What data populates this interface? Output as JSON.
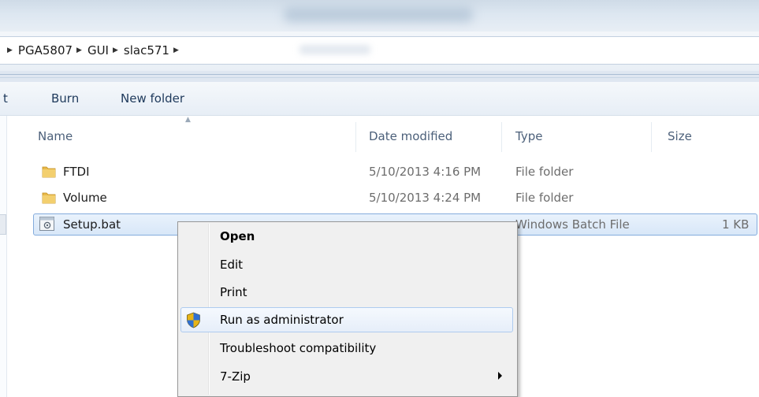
{
  "window": {
    "title": ""
  },
  "address_bar": {
    "crumbs": [
      {
        "label": "PGA5807"
      },
      {
        "label": "GUI"
      },
      {
        "label": "slac571"
      }
    ]
  },
  "command_bar": {
    "partial_label": "t",
    "burn_label": "Burn",
    "new_folder_label": "New folder"
  },
  "columns": {
    "name": "Name",
    "date_modified": "Date modified",
    "type": "Type",
    "size": "Size"
  },
  "files": [
    {
      "name": "FTDI",
      "date": "5/10/2013 4:16 PM",
      "type": "File folder",
      "size": "",
      "icon": "folder-icon"
    },
    {
      "name": "Volume",
      "date": "5/10/2013 4:24 PM",
      "type": "File folder",
      "size": "",
      "icon": "folder-icon"
    },
    {
      "name": "Setup.bat",
      "date": "",
      "type": "Windows Batch File",
      "size": "1 KB",
      "icon": "batch-file-icon",
      "selected": true
    }
  ],
  "context_menu": {
    "items": [
      {
        "label": "Open",
        "bold": true
      },
      {
        "label": "Edit"
      },
      {
        "label": "Print"
      },
      {
        "label": "Run as administrator",
        "icon": "uac-shield-icon",
        "hover": true
      },
      {
        "label": "Troubleshoot compatibility"
      },
      {
        "label": "7-Zip",
        "submenu": true
      }
    ]
  },
  "colors": {
    "accent": "#84acdd",
    "selection_bg": "#d8e7f8",
    "menu_bg": "#f0f0f0",
    "toolbar_text": "#1e395b"
  }
}
